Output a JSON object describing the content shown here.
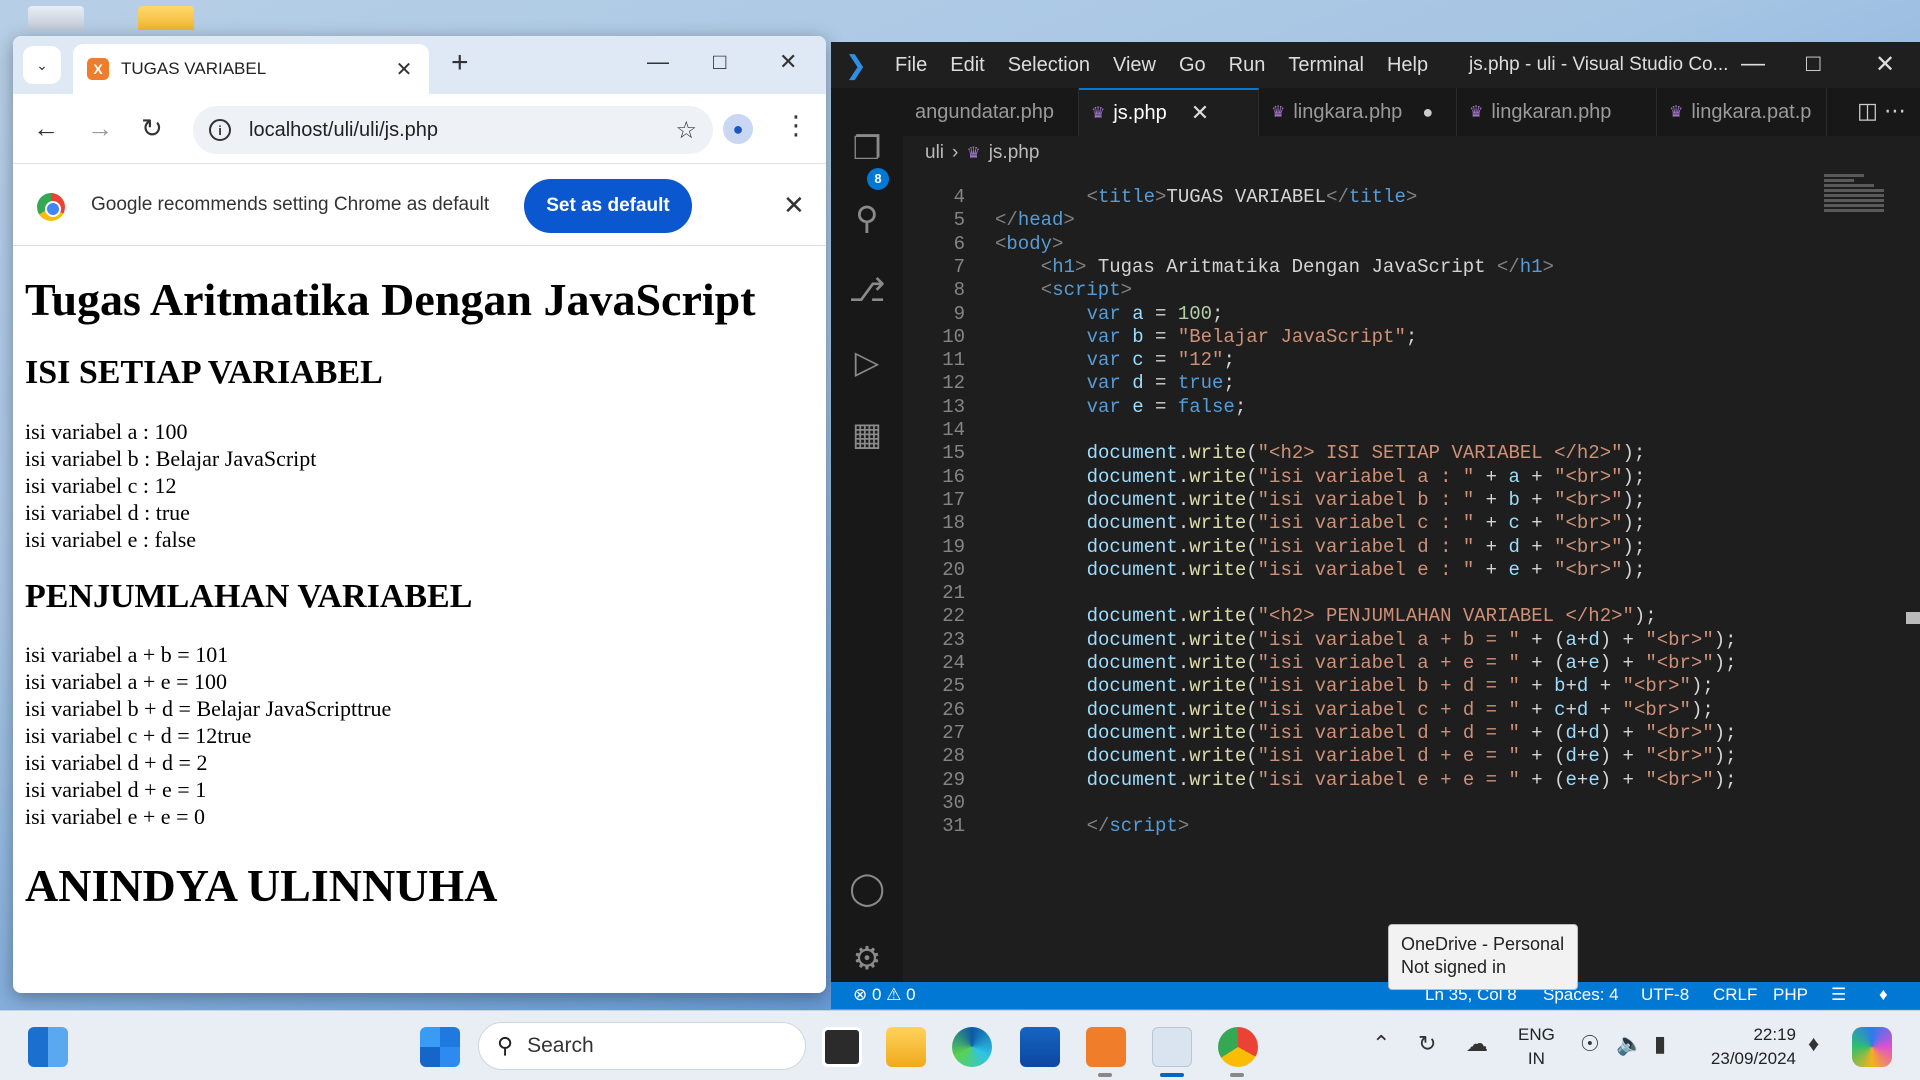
{
  "chrome": {
    "tab_title": "TUGAS VARIABEL",
    "tab_favicon": "X",
    "url": "localhost/uli/uli/js.php",
    "infobar_text": "Google recommends setting Chrome as default",
    "set_default_label": "Set as default",
    "page": {
      "h1": "Tugas Aritmatika Dengan JavaScript",
      "section1_title": "ISI SETIAP VARIABEL",
      "section1_lines": [
        "isi variabel a : 100",
        "isi variabel b : Belajar JavaScript",
        "isi variabel c : 12",
        "isi variabel d : true",
        "isi variabel e : false"
      ],
      "section2_title": "PENJUMLAHAN VARIABEL",
      "section2_lines": [
        "isi variabel a + b = 101",
        "isi variabel a + e = 100",
        "isi variabel b + d = Belajar JavaScripttrue",
        "isi variabel c + d = 12true",
        "isi variabel d + d = 2",
        "isi variabel d + e = 1",
        "isi variabel e + e = 0"
      ],
      "footer": "ANINDYA ULINNUHA"
    }
  },
  "vscode": {
    "menu": [
      "File",
      "Edit",
      "Selection",
      "View",
      "Go",
      "Run",
      "Terminal",
      "Help"
    ],
    "title": "js.php - uli - Visual Studio Co...",
    "explorer_badge": "8",
    "tabs": [
      {
        "label": "angundatar.php",
        "active": false
      },
      {
        "label": "js.php",
        "active": true
      },
      {
        "label": "lingkara.php",
        "active": false,
        "dirty": true
      },
      {
        "label": "lingkaran.php",
        "active": false
      },
      {
        "label": "lingkara.pat.p",
        "active": false
      }
    ],
    "breadcrumbs": [
      "uli",
      "js.php"
    ],
    "code_lines": [
      {
        "n": "4",
        "tokens": [
          [
            "br",
            "<"
          ],
          [
            "tag",
            "title"
          ],
          [
            "br",
            ">"
          ],
          [
            "txt",
            "TUGAS VARIABEL"
          ],
          [
            "br",
            "</"
          ],
          [
            "tag",
            "title"
          ],
          [
            "br",
            ">"
          ]
        ],
        "indent": 8
      },
      {
        "n": "5",
        "tokens": [
          [
            "br",
            "</"
          ],
          [
            "tag",
            "head"
          ],
          [
            "br",
            ">"
          ]
        ],
        "indent": 0
      },
      {
        "n": "6",
        "tokens": [
          [
            "br",
            "<"
          ],
          [
            "tag",
            "body"
          ],
          [
            "br",
            ">"
          ]
        ],
        "indent": 0
      },
      {
        "n": "7",
        "tokens": [
          [
            "br",
            "<"
          ],
          [
            "tag",
            "h1"
          ],
          [
            "br",
            "> "
          ],
          [
            "txt",
            "Tugas Aritmatika Dengan JavaScript "
          ],
          [
            "br",
            "</"
          ],
          [
            "tag",
            "h1"
          ],
          [
            "br",
            ">"
          ]
        ],
        "indent": 4
      },
      {
        "n": "8",
        "tokens": [
          [
            "br",
            "<"
          ],
          [
            "tag",
            "script"
          ],
          [
            "br",
            ">"
          ]
        ],
        "indent": 4
      },
      {
        "n": "9",
        "tokens": [
          [
            "kw",
            "var "
          ],
          [
            "var",
            "a"
          ],
          [
            "txt",
            " = "
          ],
          [
            "num",
            "100"
          ],
          [
            "txt",
            ";"
          ]
        ],
        "indent": 8
      },
      {
        "n": "10",
        "tokens": [
          [
            "kw",
            "var "
          ],
          [
            "var",
            "b"
          ],
          [
            "txt",
            " = "
          ],
          [
            "str",
            "\"Belajar JavaScript\""
          ],
          [
            "txt",
            ";"
          ]
        ],
        "indent": 8
      },
      {
        "n": "11",
        "tokens": [
          [
            "kw",
            "var "
          ],
          [
            "var",
            "c"
          ],
          [
            "txt",
            " = "
          ],
          [
            "str",
            "\"12\""
          ],
          [
            "txt",
            ";"
          ]
        ],
        "indent": 8
      },
      {
        "n": "12",
        "tokens": [
          [
            "kw",
            "var "
          ],
          [
            "var",
            "d"
          ],
          [
            "txt",
            " = "
          ],
          [
            "kw",
            "true"
          ],
          [
            "txt",
            ";"
          ]
        ],
        "indent": 8
      },
      {
        "n": "13",
        "tokens": [
          [
            "kw",
            "var "
          ],
          [
            "var",
            "e"
          ],
          [
            "txt",
            " = "
          ],
          [
            "kw",
            "false"
          ],
          [
            "txt",
            ";"
          ]
        ],
        "indent": 8
      },
      {
        "n": "14",
        "tokens": [],
        "indent": 0
      },
      {
        "n": "15",
        "tokens": [
          [
            "var",
            "document"
          ],
          [
            "txt",
            "."
          ],
          [
            "fn",
            "write"
          ],
          [
            "txt",
            "("
          ],
          [
            "str",
            "\"<h2> ISI SETIAP VARIABEL </h2>\""
          ],
          [
            "txt",
            ");"
          ]
        ],
        "indent": 8
      },
      {
        "n": "16",
        "tokens": [
          [
            "var",
            "document"
          ],
          [
            "txt",
            "."
          ],
          [
            "fn",
            "write"
          ],
          [
            "txt",
            "("
          ],
          [
            "str",
            "\"isi variabel a : \""
          ],
          [
            "txt",
            " + "
          ],
          [
            "var",
            "a"
          ],
          [
            "txt",
            " + "
          ],
          [
            "str",
            "\"<br>\""
          ],
          [
            "txt",
            ");"
          ]
        ],
        "indent": 8
      },
      {
        "n": "17",
        "tokens": [
          [
            "var",
            "document"
          ],
          [
            "txt",
            "."
          ],
          [
            "fn",
            "write"
          ],
          [
            "txt",
            "("
          ],
          [
            "str",
            "\"isi variabel b : \""
          ],
          [
            "txt",
            " + "
          ],
          [
            "var",
            "b"
          ],
          [
            "txt",
            " + "
          ],
          [
            "str",
            "\"<br>\""
          ],
          [
            "txt",
            ");"
          ]
        ],
        "indent": 8
      },
      {
        "n": "18",
        "tokens": [
          [
            "var",
            "document"
          ],
          [
            "txt",
            "."
          ],
          [
            "fn",
            "write"
          ],
          [
            "txt",
            "("
          ],
          [
            "str",
            "\"isi variabel c : \""
          ],
          [
            "txt",
            " + "
          ],
          [
            "var",
            "c"
          ],
          [
            "txt",
            " + "
          ],
          [
            "str",
            "\"<br>\""
          ],
          [
            "txt",
            ");"
          ]
        ],
        "indent": 8
      },
      {
        "n": "19",
        "tokens": [
          [
            "var",
            "document"
          ],
          [
            "txt",
            "."
          ],
          [
            "fn",
            "write"
          ],
          [
            "txt",
            "("
          ],
          [
            "str",
            "\"isi variabel d : \""
          ],
          [
            "txt",
            " + "
          ],
          [
            "var",
            "d"
          ],
          [
            "txt",
            " + "
          ],
          [
            "str",
            "\"<br>\""
          ],
          [
            "txt",
            ");"
          ]
        ],
        "indent": 8
      },
      {
        "n": "20",
        "tokens": [
          [
            "var",
            "document"
          ],
          [
            "txt",
            "."
          ],
          [
            "fn",
            "write"
          ],
          [
            "txt",
            "("
          ],
          [
            "str",
            "\"isi variabel e : \""
          ],
          [
            "txt",
            " + "
          ],
          [
            "var",
            "e"
          ],
          [
            "txt",
            " + "
          ],
          [
            "str",
            "\"<br>\""
          ],
          [
            "txt",
            ");"
          ]
        ],
        "indent": 8
      },
      {
        "n": "21",
        "tokens": [],
        "indent": 0
      },
      {
        "n": "22",
        "tokens": [
          [
            "var",
            "document"
          ],
          [
            "txt",
            "."
          ],
          [
            "fn",
            "write"
          ],
          [
            "txt",
            "("
          ],
          [
            "str",
            "\"<h2> PENJUMLAHAN VARIABEL </h2>\""
          ],
          [
            "txt",
            ");"
          ]
        ],
        "indent": 8
      },
      {
        "n": "23",
        "tokens": [
          [
            "var",
            "document"
          ],
          [
            "txt",
            "."
          ],
          [
            "fn",
            "write"
          ],
          [
            "txt",
            "("
          ],
          [
            "str",
            "\"isi variabel a + b = \""
          ],
          [
            "txt",
            " + ("
          ],
          [
            "var",
            "a"
          ],
          [
            "txt",
            "+"
          ],
          [
            "var",
            "d"
          ],
          [
            "txt",
            ") + "
          ],
          [
            "str",
            "\"<br>\""
          ],
          [
            "txt",
            ");"
          ]
        ],
        "indent": 8
      },
      {
        "n": "24",
        "tokens": [
          [
            "var",
            "document"
          ],
          [
            "txt",
            "."
          ],
          [
            "fn",
            "write"
          ],
          [
            "txt",
            "("
          ],
          [
            "str",
            "\"isi variabel a + e = \""
          ],
          [
            "txt",
            " + ("
          ],
          [
            "var",
            "a"
          ],
          [
            "txt",
            "+"
          ],
          [
            "var",
            "e"
          ],
          [
            "txt",
            ") + "
          ],
          [
            "str",
            "\"<br>\""
          ],
          [
            "txt",
            ");"
          ]
        ],
        "indent": 8
      },
      {
        "n": "25",
        "tokens": [
          [
            "var",
            "document"
          ],
          [
            "txt",
            "."
          ],
          [
            "fn",
            "write"
          ],
          [
            "txt",
            "("
          ],
          [
            "str",
            "\"isi variabel b + d = \""
          ],
          [
            "txt",
            " + "
          ],
          [
            "var",
            "b"
          ],
          [
            "txt",
            "+"
          ],
          [
            "var",
            "d"
          ],
          [
            "txt",
            " + "
          ],
          [
            "str",
            "\"<br>\""
          ],
          [
            "txt",
            ");"
          ]
        ],
        "indent": 8
      },
      {
        "n": "26",
        "tokens": [
          [
            "var",
            "document"
          ],
          [
            "txt",
            "."
          ],
          [
            "fn",
            "write"
          ],
          [
            "txt",
            "("
          ],
          [
            "str",
            "\"isi variabel c + d = \""
          ],
          [
            "txt",
            " + "
          ],
          [
            "var",
            "c"
          ],
          [
            "txt",
            "+"
          ],
          [
            "var",
            "d"
          ],
          [
            "txt",
            " + "
          ],
          [
            "str",
            "\"<br>\""
          ],
          [
            "txt",
            ");"
          ]
        ],
        "indent": 8
      },
      {
        "n": "27",
        "tokens": [
          [
            "var",
            "document"
          ],
          [
            "txt",
            "."
          ],
          [
            "fn",
            "write"
          ],
          [
            "txt",
            "("
          ],
          [
            "str",
            "\"isi variabel d + d = \""
          ],
          [
            "txt",
            " + ("
          ],
          [
            "var",
            "d"
          ],
          [
            "txt",
            "+"
          ],
          [
            "var",
            "d"
          ],
          [
            "txt",
            ") + "
          ],
          [
            "str",
            "\"<br>\""
          ],
          [
            "txt",
            ");"
          ]
        ],
        "indent": 8
      },
      {
        "n": "28",
        "tokens": [
          [
            "var",
            "document"
          ],
          [
            "txt",
            "."
          ],
          [
            "fn",
            "write"
          ],
          [
            "txt",
            "("
          ],
          [
            "str",
            "\"isi variabel d + e = \""
          ],
          [
            "txt",
            " + ("
          ],
          [
            "var",
            "d"
          ],
          [
            "txt",
            "+"
          ],
          [
            "var",
            "e"
          ],
          [
            "txt",
            ") + "
          ],
          [
            "str",
            "\"<br>\""
          ],
          [
            "txt",
            ");"
          ]
        ],
        "indent": 8
      },
      {
        "n": "29",
        "tokens": [
          [
            "var",
            "document"
          ],
          [
            "txt",
            "."
          ],
          [
            "fn",
            "write"
          ],
          [
            "txt",
            "("
          ],
          [
            "str",
            "\"isi variabel e + e = \""
          ],
          [
            "txt",
            " + ("
          ],
          [
            "var",
            "e"
          ],
          [
            "txt",
            "+"
          ],
          [
            "var",
            "e"
          ],
          [
            "txt",
            ") + "
          ],
          [
            "str",
            "\"<br>\""
          ],
          [
            "txt",
            ");"
          ]
        ],
        "indent": 8
      },
      {
        "n": "30",
        "tokens": [],
        "indent": 0
      },
      {
        "n": "31",
        "tokens": [
          [
            "br",
            "</"
          ],
          [
            "tag",
            "script"
          ],
          [
            "br",
            ">"
          ]
        ],
        "indent": 8
      }
    ],
    "tooltip_line1": "OneDrive - Personal",
    "tooltip_line2": "Not signed in",
    "status": {
      "problems": "⊗ 0 ⚠ 0",
      "position": "Ln 35, Col 8",
      "spaces": "Spaces: 4",
      "encoding": "UTF-8",
      "eol": "CRLF",
      "language": "PHP"
    }
  },
  "taskbar": {
    "search_label": "Search",
    "lang_line1": "ENG",
    "lang_line2": "IN",
    "time": "22:19",
    "date": "23/09/2024"
  }
}
